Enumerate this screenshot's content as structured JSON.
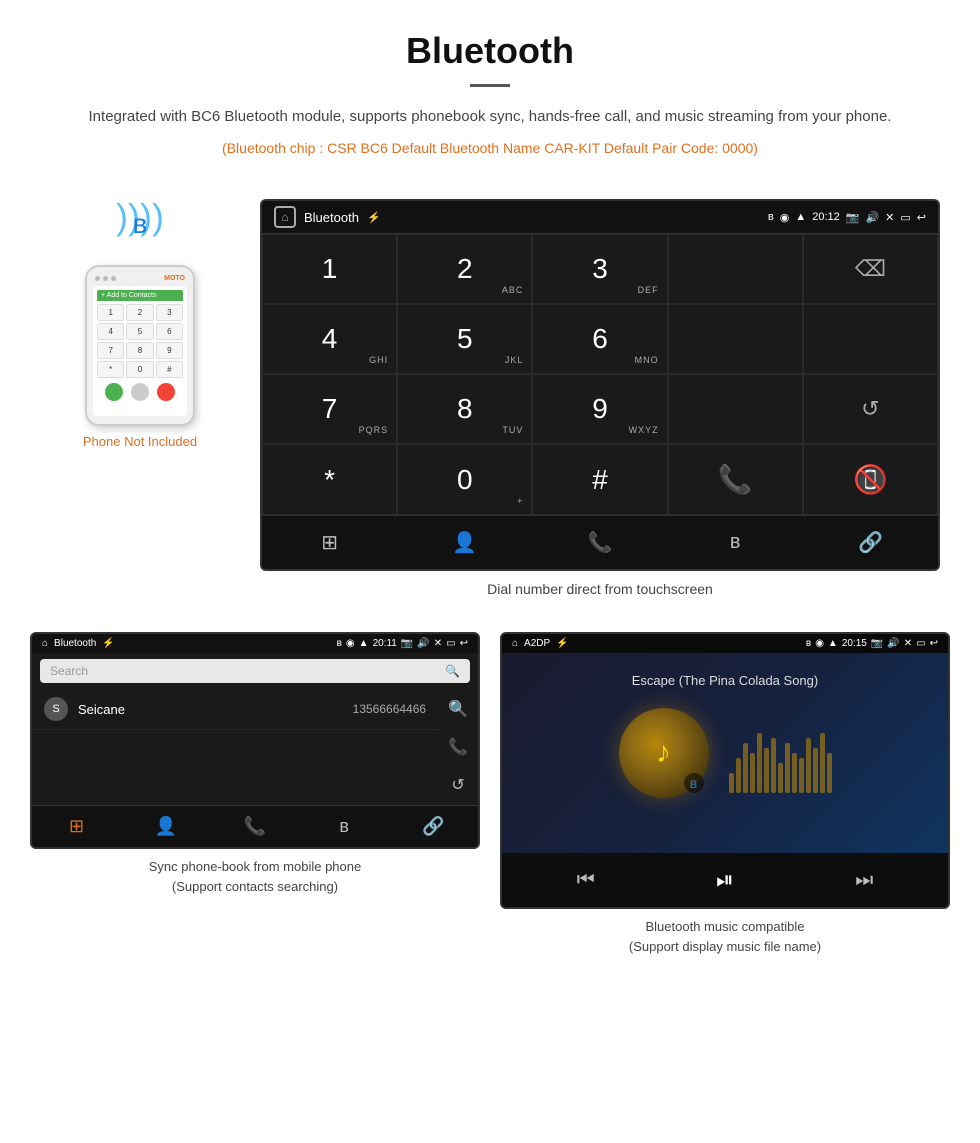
{
  "header": {
    "title": "Bluetooth",
    "description": "Integrated with BC6 Bluetooth module, supports phonebook sync, hands-free call, and music streaming from your phone.",
    "specs": "(Bluetooth chip : CSR BC6    Default Bluetooth Name CAR-KIT    Default Pair Code: 0000)"
  },
  "phone_note": {
    "not_included": "Phone Not Included"
  },
  "dial_screen": {
    "status_bar": {
      "title": "Bluetooth",
      "time": "20:12"
    },
    "keys": [
      {
        "main": "1",
        "sub": ""
      },
      {
        "main": "2",
        "sub": "ABC"
      },
      {
        "main": "3",
        "sub": "DEF"
      },
      {
        "main": "",
        "sub": ""
      },
      {
        "main": "⌫",
        "sub": ""
      },
      {
        "main": "4",
        "sub": "GHI"
      },
      {
        "main": "5",
        "sub": "JKL"
      },
      {
        "main": "6",
        "sub": "MNO"
      },
      {
        "main": "",
        "sub": ""
      },
      {
        "main": "",
        "sub": ""
      },
      {
        "main": "7",
        "sub": "PQRS"
      },
      {
        "main": "8",
        "sub": "TUV"
      },
      {
        "main": "9",
        "sub": "WXYZ"
      },
      {
        "main": "",
        "sub": ""
      },
      {
        "main": "↺",
        "sub": ""
      },
      {
        "main": "*",
        "sub": ""
      },
      {
        "main": "0",
        "sub": "+"
      },
      {
        "main": "#",
        "sub": ""
      },
      {
        "main": "📞",
        "sub": ""
      },
      {
        "main": "📵",
        "sub": ""
      }
    ],
    "caption": "Dial number direct from touchscreen"
  },
  "phonebook_screen": {
    "status_bar": {
      "title": "Bluetooth",
      "time": "20:11"
    },
    "search_placeholder": "Search",
    "contact": {
      "initial": "S",
      "name": "Seicane",
      "phone": "13566664466"
    },
    "caption_line1": "Sync phone-book from mobile phone",
    "caption_line2": "(Support contacts searching)"
  },
  "music_screen": {
    "status_bar": {
      "title": "A2DP",
      "time": "20:15"
    },
    "song_title": "Escape (The Pina Colada Song)",
    "caption_line1": "Bluetooth music compatible",
    "caption_line2": "(Support display music file name)"
  },
  "icons": {
    "home": "⌂",
    "bluetooth": "ʙ",
    "usb": "⚡",
    "camera": "📷",
    "volume": "🔊",
    "close_x": "✕",
    "window": "⬜",
    "back": "↩",
    "grid": "⊞",
    "person": "👤",
    "phone": "📞",
    "bt": "ʙ",
    "link": "🔗",
    "skip_prev": "⏮",
    "play_pause": "⏯",
    "skip_next": "⏭",
    "search": "🔍",
    "refresh": "↺",
    "backspace": "⌫"
  },
  "eq_bars": [
    20,
    35,
    50,
    40,
    60,
    45,
    55,
    30,
    50,
    40,
    35,
    55,
    45,
    60,
    40
  ]
}
